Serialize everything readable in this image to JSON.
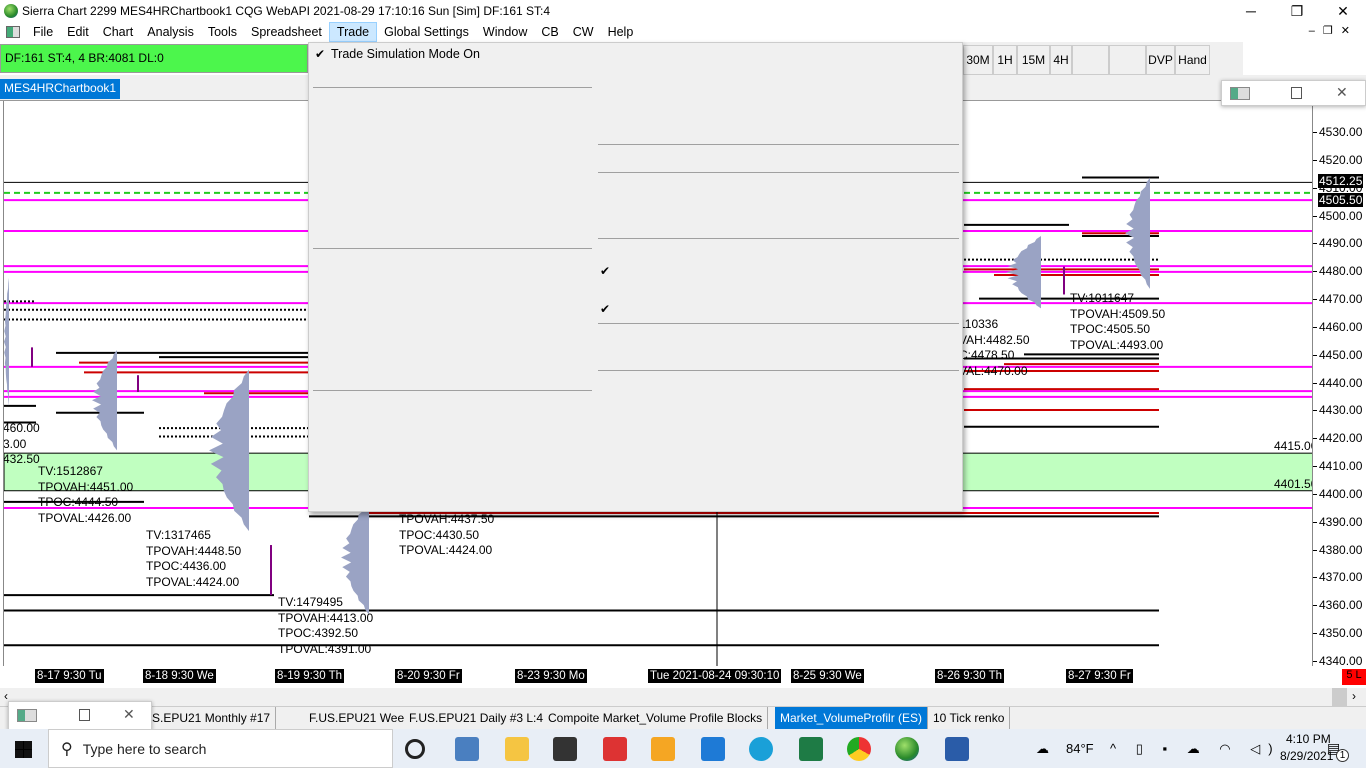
{
  "window": {
    "title": "Sierra Chart 2299 MES4HRChartbook1  CQG WebAPI 2021-08-29  17:10:16 Sun [Sim]  DF:161  ST:4",
    "minimize": "─",
    "restore": "❐",
    "close": "✕"
  },
  "menu": [
    "File",
    "Edit",
    "Chart",
    "Analysis",
    "Tools",
    "Spreadsheet",
    "Trade",
    "Global Settings",
    "Window",
    "CB",
    "CW",
    "Help"
  ],
  "status": "DF:161  ST:4, 4  BR:4081  DL:0",
  "toolbar": [
    "30M",
    "1H",
    "15M",
    "4H",
    "",
    "",
    "DVP",
    "Hand"
  ],
  "chartbook_tab": "MES4HRChartbook1",
  "trade_menu": {
    "items": [
      {
        "label": "Trade Simulation Mode On",
        "checked": true
      }
    ],
    "check": "✔"
  },
  "chart_data": {
    "type": "line",
    "title": "MES 4HR Market Volume Profile",
    "ylim": [
      4337,
      4540
    ],
    "y_ticks": [
      4530,
      4520,
      4510,
      4500,
      4490,
      4480,
      4470,
      4460,
      4450,
      4440,
      4430,
      4420,
      4410,
      4400,
      4390,
      4380,
      4370,
      4360,
      4350,
      4340
    ],
    "price_labels": {
      "last": "4512.25",
      "poc": "4505.50"
    },
    "zone": {
      "high": 4415,
      "low": 4401.5,
      "high_label": "4415.00",
      "low_label": "4401.50",
      "color": "#c0ffc0"
    },
    "x_labels": [
      "8-17  9:30 Tu",
      "8-18  9:30 We",
      "8-19  9:30 Th",
      "8-20  9:30 Fr",
      "8-23  9:30 Mo",
      "Tue 2021-08-24  09:30:10",
      "8-25  9:30 We",
      "8-26  9:30 Th",
      "8-27  9:30 Fr"
    ],
    "corner_label": "5 L",
    "colors": {
      "magenta": "#ff00ff",
      "red": "#cc0000",
      "black": "#000000",
      "profile": "#9aa3c4",
      "green_dash": "#22cc22"
    },
    "annotations": [
      {
        "lines": [
          "460.00",
          "3.00",
          "432.50"
        ]
      },
      {
        "lines": [
          "TV:1512867",
          "TPOVAH:4451.00",
          "TPOC:4444.50",
          "TPOVAL:4426.00"
        ]
      },
      {
        "lines": [
          "TV:1317465",
          "TPOVAH:4448.50",
          "TPOC:4436.00",
          "TPOVAL:4424.00"
        ]
      },
      {
        "lines": [
          "TV:1479495",
          "TPOVAH:4413.00",
          "TPOC:4392.50",
          "TPOVAL:4391.00"
        ]
      },
      {
        "lines": [
          "TPOVAH:4437.50",
          "TPOC:4430.50",
          "TPOVAL:4424.00"
        ]
      },
      {
        "lines": [
          "110336",
          "VAH:4482.50",
          "C:4478.50",
          "VAL:4470.00"
        ]
      },
      {
        "lines": [
          "TV:1011647",
          "TPOVAH:4509.50",
          "TPOC:4505.50",
          "TPOVAL:4493.00"
        ]
      }
    ]
  },
  "sheets": [
    "F",
    "S.EPU21  Monthly  #17",
    "F.US.EPU21  Weekly  #4",
    "F.US.EPU21  Daily  #3 L:4",
    "Compoite Market_Volume Profile Blocks",
    "Market_VolumeProfilr (ES)",
    "10 Tick renko"
  ],
  "taskbar": {
    "search_placeholder": "Type here to search",
    "weather": "84°F",
    "time": "4:10 PM",
    "date": "8/29/2021",
    "notifications": "1"
  }
}
